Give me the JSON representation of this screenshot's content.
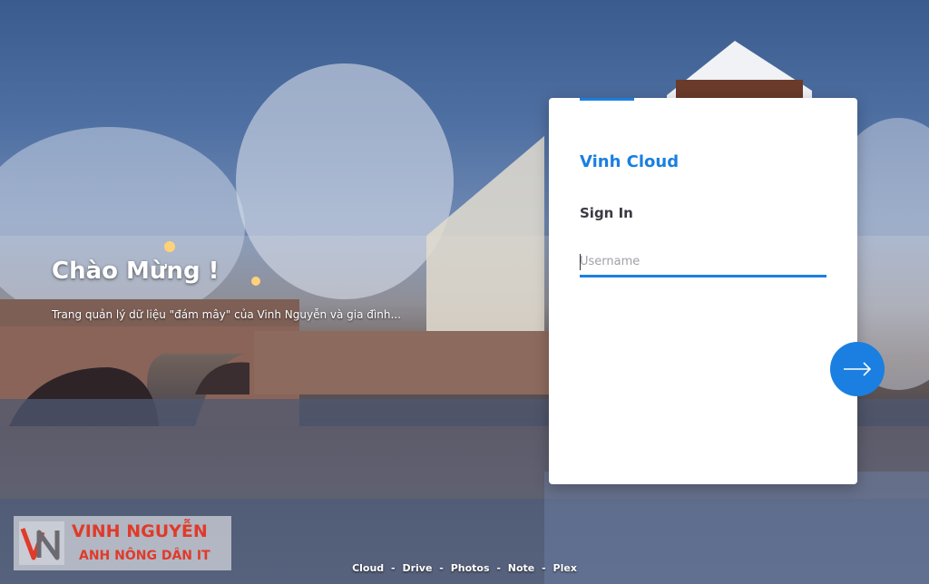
{
  "welcome": {
    "title": "Chào Mừng !",
    "subtitle": "Trang quản lý dữ liệu \"đám mây\" của Vinh Nguyễn và gia đình..."
  },
  "login": {
    "brand": "Vinh Cloud",
    "heading": "Sign In",
    "username_placeholder": "Username",
    "username_value": ""
  },
  "watermark": {
    "title": "VINH NGUYỄN",
    "subtitle": "ANH NÔNG DÂN IT"
  },
  "footer": {
    "links": [
      "Cloud",
      "Drive",
      "Photos",
      "Note",
      "Plex"
    ],
    "separator": "-"
  },
  "colors": {
    "accent": "#1a7fe0",
    "watermark": "#e03a2a"
  },
  "icons": {
    "next": "arrow-right-icon"
  }
}
